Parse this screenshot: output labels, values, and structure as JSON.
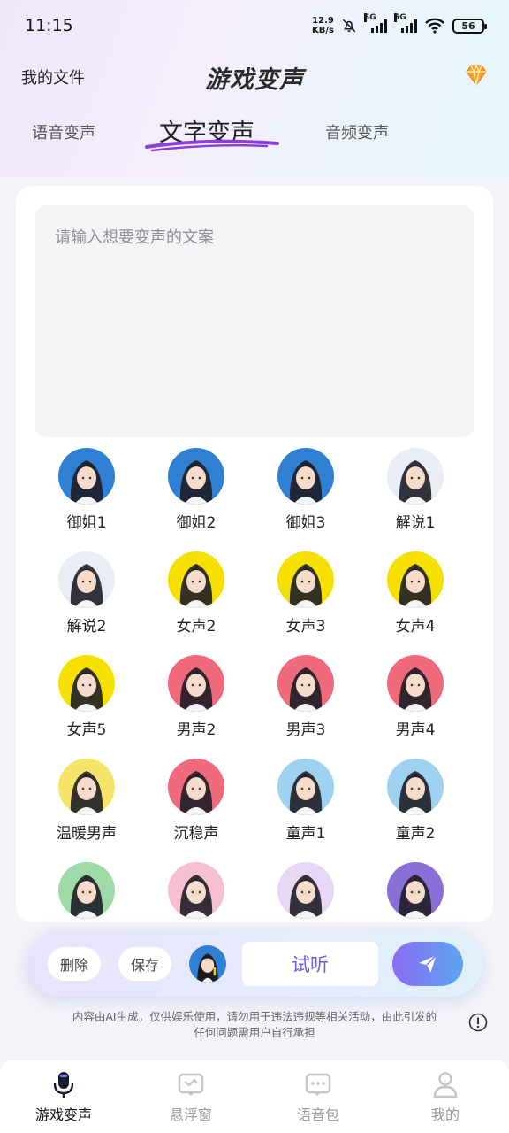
{
  "status_bar": {
    "time": "11:15",
    "net_speed_value": "12.9",
    "net_speed_unit": "KB/s",
    "signal1_label": "5G",
    "signal2_label": "5G",
    "battery": "56"
  },
  "header": {
    "left_link": "我的文件",
    "title": "游戏变声"
  },
  "tabs": [
    {
      "label": "语音变声",
      "active": false
    },
    {
      "label": "文字变声",
      "active": true
    },
    {
      "label": "音频变声",
      "active": false
    }
  ],
  "text_input": {
    "placeholder": "请输入想要变声的文案",
    "value": ""
  },
  "voices": [
    {
      "label": "御姐1",
      "bg": "#2f7fd3"
    },
    {
      "label": "御姐2",
      "bg": "#2f7fd3"
    },
    {
      "label": "御姐3",
      "bg": "#2f7fd3"
    },
    {
      "label": "解说1",
      "bg": "#e8eef3"
    },
    {
      "label": "解说2",
      "bg": "#e8eef3"
    },
    {
      "label": "女声2",
      "bg": "#f5e000"
    },
    {
      "label": "女声3",
      "bg": "#f5e000"
    },
    {
      "label": "女声4",
      "bg": "#f5e000"
    },
    {
      "label": "女声5",
      "bg": "#f5e000"
    },
    {
      "label": "男声2",
      "bg": "#ef6b7c"
    },
    {
      "label": "男声3",
      "bg": "#ef6b7c"
    },
    {
      "label": "男声4",
      "bg": "#ef6b7c"
    },
    {
      "label": "温暖男声",
      "bg": "#f6e36a"
    },
    {
      "label": "沉稳声",
      "bg": "#ef6b7c"
    },
    {
      "label": "童声1",
      "bg": "#9ed0ef"
    },
    {
      "label": "童声2",
      "bg": "#9ed0ef"
    },
    {
      "label": "",
      "bg": "#9ed9a8"
    },
    {
      "label": "",
      "bg": "#f6c0d0"
    },
    {
      "label": "",
      "bg": "#e7d8f5"
    },
    {
      "label": "",
      "bg": "#8a6fd6"
    }
  ],
  "action_bar": {
    "delete_label": "删除",
    "save_label": "保存",
    "listen_label": "试听"
  },
  "disclaimer": "内容由AI生成，仅供娱乐使用，请勿用于违法违规等相关活动，由此引发的任何问题需用户自行承担",
  "bottom_nav": [
    {
      "label": "游戏变声",
      "icon": "microphone-icon",
      "active": true
    },
    {
      "label": "悬浮窗",
      "icon": "floating-window-icon",
      "active": false
    },
    {
      "label": "语音包",
      "icon": "voice-pack-icon",
      "active": false
    },
    {
      "label": "我的",
      "icon": "profile-icon",
      "active": false
    }
  ],
  "colors": {
    "accent": "#6a5cf0",
    "underline": "#8b3fd6"
  }
}
